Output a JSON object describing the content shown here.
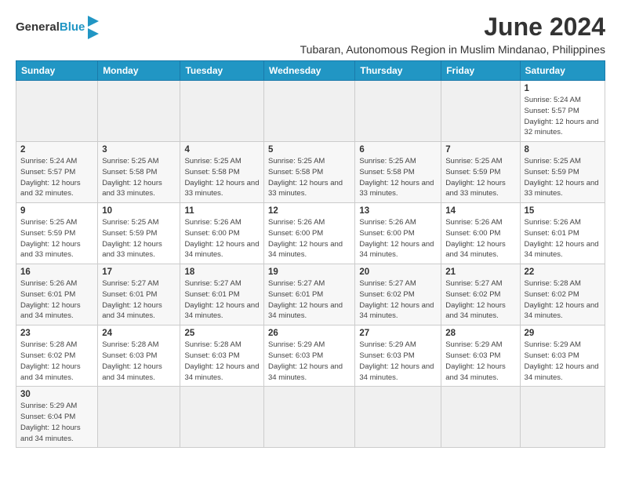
{
  "header": {
    "logo_line1": "General",
    "logo_line2": "Blue",
    "main_title": "June 2024",
    "subtitle": "Tubaran, Autonomous Region in Muslim Mindanao, Philippines"
  },
  "days_of_week": [
    "Sunday",
    "Monday",
    "Tuesday",
    "Wednesday",
    "Thursday",
    "Friday",
    "Saturday"
  ],
  "weeks": [
    [
      {
        "day": "",
        "info": ""
      },
      {
        "day": "",
        "info": ""
      },
      {
        "day": "",
        "info": ""
      },
      {
        "day": "",
        "info": ""
      },
      {
        "day": "",
        "info": ""
      },
      {
        "day": "",
        "info": ""
      },
      {
        "day": "1",
        "info": "Sunrise: 5:24 AM\nSunset: 5:57 PM\nDaylight: 12 hours and 32 minutes."
      }
    ],
    [
      {
        "day": "2",
        "info": "Sunrise: 5:24 AM\nSunset: 5:57 PM\nDaylight: 12 hours and 32 minutes."
      },
      {
        "day": "3",
        "info": "Sunrise: 5:25 AM\nSunset: 5:58 PM\nDaylight: 12 hours and 33 minutes."
      },
      {
        "day": "4",
        "info": "Sunrise: 5:25 AM\nSunset: 5:58 PM\nDaylight: 12 hours and 33 minutes."
      },
      {
        "day": "5",
        "info": "Sunrise: 5:25 AM\nSunset: 5:58 PM\nDaylight: 12 hours and 33 minutes."
      },
      {
        "day": "6",
        "info": "Sunrise: 5:25 AM\nSunset: 5:58 PM\nDaylight: 12 hours and 33 minutes."
      },
      {
        "day": "7",
        "info": "Sunrise: 5:25 AM\nSunset: 5:59 PM\nDaylight: 12 hours and 33 minutes."
      },
      {
        "day": "8",
        "info": "Sunrise: 5:25 AM\nSunset: 5:59 PM\nDaylight: 12 hours and 33 minutes."
      }
    ],
    [
      {
        "day": "9",
        "info": "Sunrise: 5:25 AM\nSunset: 5:59 PM\nDaylight: 12 hours and 33 minutes."
      },
      {
        "day": "10",
        "info": "Sunrise: 5:25 AM\nSunset: 5:59 PM\nDaylight: 12 hours and 33 minutes."
      },
      {
        "day": "11",
        "info": "Sunrise: 5:26 AM\nSunset: 6:00 PM\nDaylight: 12 hours and 34 minutes."
      },
      {
        "day": "12",
        "info": "Sunrise: 5:26 AM\nSunset: 6:00 PM\nDaylight: 12 hours and 34 minutes."
      },
      {
        "day": "13",
        "info": "Sunrise: 5:26 AM\nSunset: 6:00 PM\nDaylight: 12 hours and 34 minutes."
      },
      {
        "day": "14",
        "info": "Sunrise: 5:26 AM\nSunset: 6:00 PM\nDaylight: 12 hours and 34 minutes."
      },
      {
        "day": "15",
        "info": "Sunrise: 5:26 AM\nSunset: 6:01 PM\nDaylight: 12 hours and 34 minutes."
      }
    ],
    [
      {
        "day": "16",
        "info": "Sunrise: 5:26 AM\nSunset: 6:01 PM\nDaylight: 12 hours and 34 minutes."
      },
      {
        "day": "17",
        "info": "Sunrise: 5:27 AM\nSunset: 6:01 PM\nDaylight: 12 hours and 34 minutes."
      },
      {
        "day": "18",
        "info": "Sunrise: 5:27 AM\nSunset: 6:01 PM\nDaylight: 12 hours and 34 minutes."
      },
      {
        "day": "19",
        "info": "Sunrise: 5:27 AM\nSunset: 6:01 PM\nDaylight: 12 hours and 34 minutes."
      },
      {
        "day": "20",
        "info": "Sunrise: 5:27 AM\nSunset: 6:02 PM\nDaylight: 12 hours and 34 minutes."
      },
      {
        "day": "21",
        "info": "Sunrise: 5:27 AM\nSunset: 6:02 PM\nDaylight: 12 hours and 34 minutes."
      },
      {
        "day": "22",
        "info": "Sunrise: 5:28 AM\nSunset: 6:02 PM\nDaylight: 12 hours and 34 minutes."
      }
    ],
    [
      {
        "day": "23",
        "info": "Sunrise: 5:28 AM\nSunset: 6:02 PM\nDaylight: 12 hours and 34 minutes."
      },
      {
        "day": "24",
        "info": "Sunrise: 5:28 AM\nSunset: 6:03 PM\nDaylight: 12 hours and 34 minutes."
      },
      {
        "day": "25",
        "info": "Sunrise: 5:28 AM\nSunset: 6:03 PM\nDaylight: 12 hours and 34 minutes."
      },
      {
        "day": "26",
        "info": "Sunrise: 5:29 AM\nSunset: 6:03 PM\nDaylight: 12 hours and 34 minutes."
      },
      {
        "day": "27",
        "info": "Sunrise: 5:29 AM\nSunset: 6:03 PM\nDaylight: 12 hours and 34 minutes."
      },
      {
        "day": "28",
        "info": "Sunrise: 5:29 AM\nSunset: 6:03 PM\nDaylight: 12 hours and 34 minutes."
      },
      {
        "day": "29",
        "info": "Sunrise: 5:29 AM\nSunset: 6:03 PM\nDaylight: 12 hours and 34 minutes."
      }
    ],
    [
      {
        "day": "30",
        "info": "Sunrise: 5:29 AM\nSunset: 6:04 PM\nDaylight: 12 hours and 34 minutes."
      },
      {
        "day": "",
        "info": ""
      },
      {
        "day": "",
        "info": ""
      },
      {
        "day": "",
        "info": ""
      },
      {
        "day": "",
        "info": ""
      },
      {
        "day": "",
        "info": ""
      },
      {
        "day": "",
        "info": ""
      }
    ]
  ],
  "accent_color": "#2196c4"
}
